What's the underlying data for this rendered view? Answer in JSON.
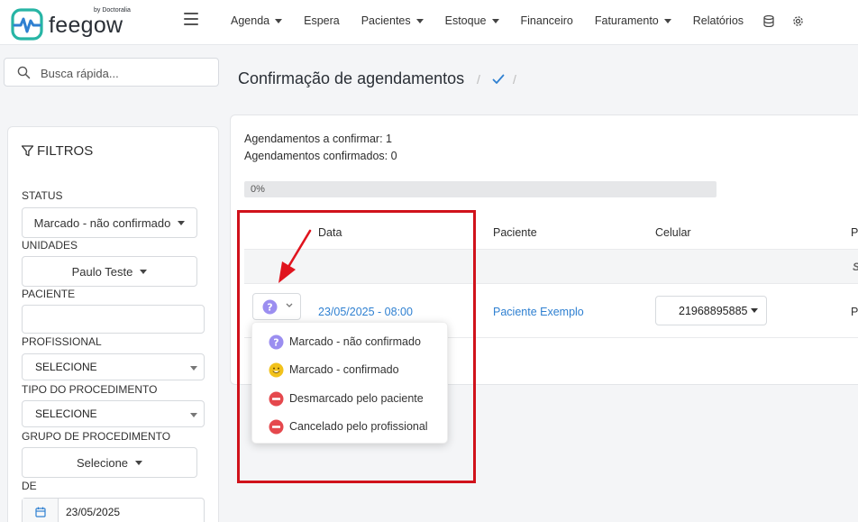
{
  "app": {
    "logo_text": "feegow",
    "logo_byline": "by Doctoralia",
    "brand_colors": {
      "teal": "#27b5a5",
      "blue": "#2f80d1",
      "dark": "#2a2f36"
    }
  },
  "nav": {
    "items": [
      {
        "label": "Agenda",
        "dropdown": true
      },
      {
        "label": "Espera",
        "dropdown": false
      },
      {
        "label": "Pacientes",
        "dropdown": true
      },
      {
        "label": "Estoque",
        "dropdown": true
      },
      {
        "label": "Financeiro",
        "dropdown": false
      },
      {
        "label": "Faturamento",
        "dropdown": true
      },
      {
        "label": "Relatórios",
        "dropdown": false
      }
    ],
    "icons": [
      "database-icon",
      "gear-icon"
    ]
  },
  "search": {
    "placeholder": "Busca rápida..."
  },
  "filters": {
    "title": "FILTROS",
    "status_label": "STATUS",
    "status_value": "Marcado - não confirmado",
    "unidades_label": "UNIDADES",
    "unidades_value": "Paulo Teste",
    "paciente_label": "PACIENTE",
    "paciente_value": "",
    "profissional_label": "PROFISSIONAL",
    "profissional_value": "SELECIONE",
    "tipo_label": "TIPO DO PROCEDIMENTO",
    "tipo_value": "SELECIONE",
    "grupo_label": "GRUPO DE PROCEDIMENTO",
    "grupo_value": "Selecione",
    "de_label": "DE",
    "de_value": "23/05/2025"
  },
  "page": {
    "title": "Confirmação de agendamentos",
    "crumb_sep": "/"
  },
  "panel": {
    "to_confirm": "Agendamentos a confirmar: 1",
    "confirmed": "Agendamentos confirmados: 0",
    "progress_text": "0%",
    "progress_value": 0,
    "columns": {
      "data": "Data",
      "paciente": "Paciente",
      "celular": "Celular",
      "cut": "P"
    },
    "group_text": "S",
    "row": {
      "datetime": "23/05/2025 - 08:00",
      "patient": "Paciente Exemplo",
      "phone": "21968895885",
      "cut": "Pa"
    }
  },
  "status_menu": {
    "items": [
      {
        "label": "Marcado - não confirmado",
        "icon": "question-circle-icon",
        "color": "#9b8ef0"
      },
      {
        "label": "Marcado - confirmado",
        "icon": "smile-icon",
        "color": "#f2c21b"
      },
      {
        "label": "Desmarcado pelo paciente",
        "icon": "minus-circle-icon",
        "color": "#e5484d"
      },
      {
        "label": "Cancelado pelo profissional",
        "icon": "minus-circle-icon",
        "color": "#e5484d"
      }
    ]
  },
  "annotation": {
    "highlight_color": "#d0121b"
  }
}
